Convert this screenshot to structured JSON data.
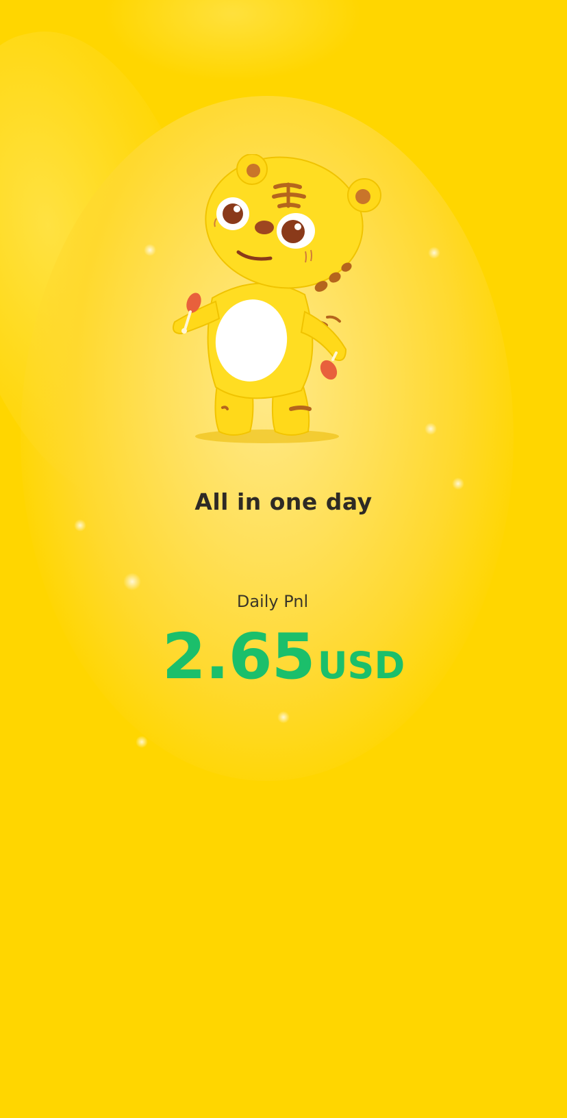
{
  "headline": "All in one day",
  "daily_pnl": {
    "label": "Daily Pnl",
    "value": "2.65",
    "unit": "USD"
  },
  "mascot": {
    "icon": "tiger-mascot-icon"
  },
  "colors": {
    "background": "#FFD600",
    "pnl_value": "#1BBF6B",
    "headline": "#2E2A25"
  }
}
